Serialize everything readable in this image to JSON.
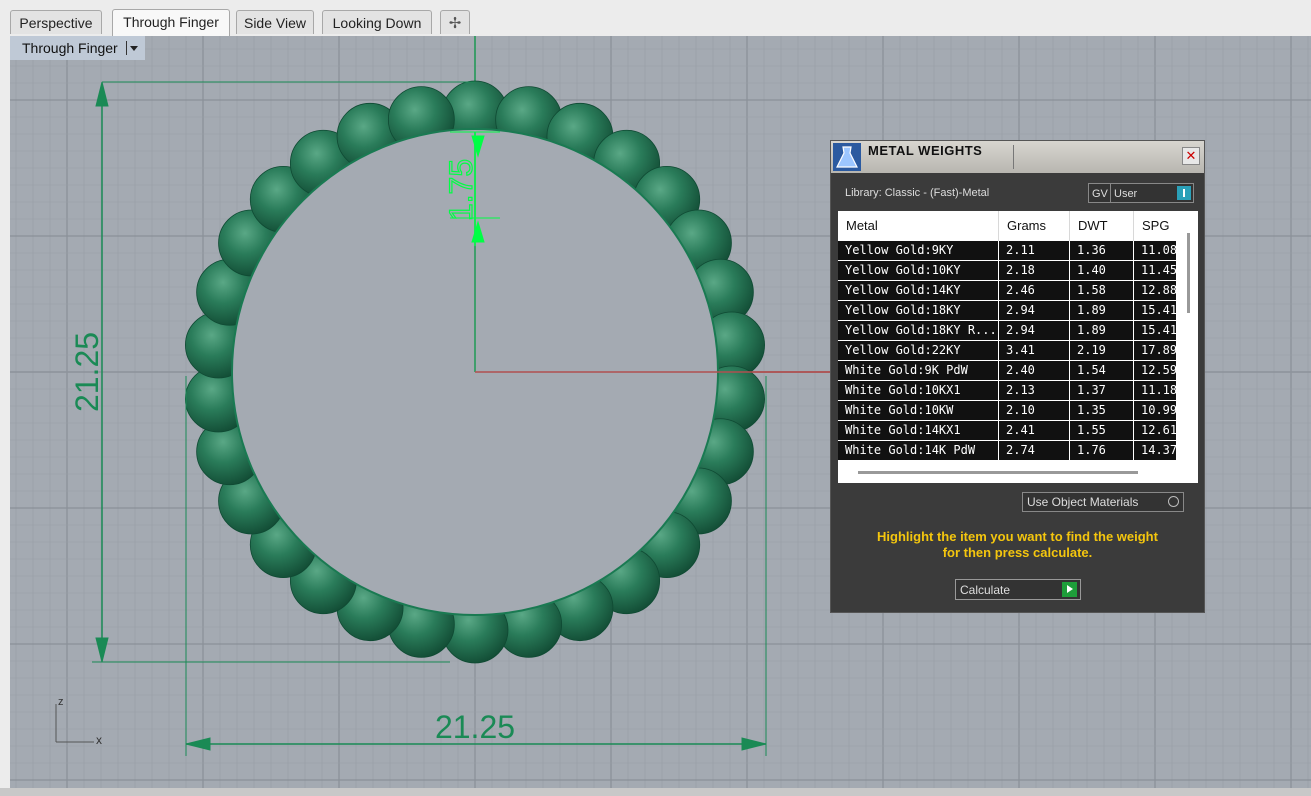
{
  "tabs": [
    {
      "label": "Perspective",
      "active": false
    },
    {
      "label": "Through Finger",
      "active": true
    },
    {
      "label": "Side View",
      "active": false
    },
    {
      "label": "Looking Down",
      "active": false
    }
  ],
  "add_tab_icon": "plus-icon",
  "viewport": {
    "label": "Through Finger",
    "dimensions": {
      "vertical": "21.25",
      "horizontal": "21.25",
      "thickness": "1.75"
    },
    "axes": {
      "z": "z",
      "x": "x"
    },
    "colors": {
      "background": "#a4aab2",
      "ring": "#1e7a56",
      "dimension": "#1a8a55",
      "marker": "#00ff44"
    }
  },
  "panel": {
    "title": "METAL WEIGHTS",
    "library": "Library: Classic - (Fast)-Metal",
    "toggles": {
      "gv": "GV",
      "user": "User"
    },
    "columns": [
      "Metal",
      "Grams",
      "DWT",
      "SPG"
    ],
    "rows": [
      [
        "Yellow Gold:9KY",
        "2.11",
        "1.36",
        "11.08"
      ],
      [
        "Yellow Gold:10KY",
        "2.18",
        "1.40",
        "11.45"
      ],
      [
        "Yellow Gold:14KY",
        "2.46",
        "1.58",
        "12.88"
      ],
      [
        "Yellow Gold:18KY",
        "2.94",
        "1.89",
        "15.41"
      ],
      [
        "Yellow Gold:18KY R...",
        "2.94",
        "1.89",
        "15.41"
      ],
      [
        "Yellow Gold:22KY",
        "3.41",
        "2.19",
        "17.89"
      ],
      [
        "White Gold:9K PdW",
        "2.40",
        "1.54",
        "12.59"
      ],
      [
        "White Gold:10KX1",
        "2.13",
        "1.37",
        "11.18"
      ],
      [
        "White Gold:10KW",
        "2.10",
        "1.35",
        "10.99"
      ],
      [
        "White Gold:14KX1",
        "2.41",
        "1.55",
        "12.61"
      ],
      [
        "White Gold:14K PdW",
        "2.74",
        "1.76",
        "14.37"
      ]
    ],
    "materials_select": "Use Object Materials",
    "instruction_line1": "Highlight the item you want to find the weight",
    "instruction_line2": "for then press calculate.",
    "calculate_label": "Calculate",
    "colors": {
      "panel_bg": "#3b3b3b",
      "instruction": "#f4c60e",
      "accent": "#2aa0b8"
    }
  }
}
